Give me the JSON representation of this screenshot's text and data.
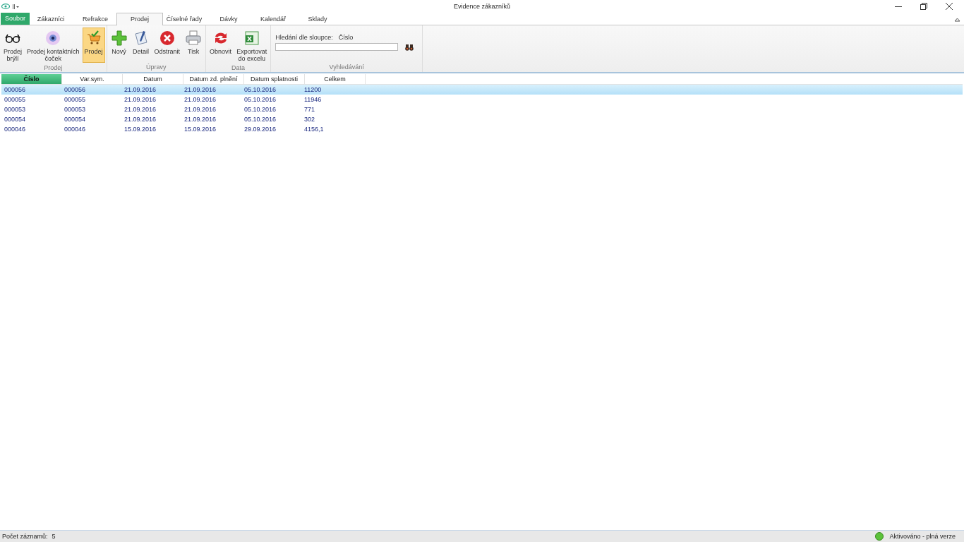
{
  "window": {
    "title": "Evidence zákazníků"
  },
  "file_tab": {
    "label": "Soubor"
  },
  "tabs": [
    {
      "label": "Zákazníci",
      "selected": false
    },
    {
      "label": "Refrakce",
      "selected": false
    },
    {
      "label": "Prodej",
      "selected": true
    },
    {
      "label": "Číselné řady",
      "selected": false
    },
    {
      "label": "Dávky",
      "selected": false
    },
    {
      "label": "Kalendář",
      "selected": false
    },
    {
      "label": "Sklady",
      "selected": false
    }
  ],
  "ribbon": {
    "groups": [
      {
        "label": "Prodej",
        "buttons": [
          {
            "lines": [
              "Prodej",
              "brýlí"
            ],
            "kind": "glasses",
            "selected": false
          },
          {
            "lines": [
              "Prodej kontaktních",
              "čoček"
            ],
            "kind": "eye",
            "selected": false
          },
          {
            "lines": [
              "Prodej"
            ],
            "kind": "cart",
            "selected": true
          }
        ]
      },
      {
        "label": "Úpravy",
        "buttons": [
          {
            "lines": [
              "Nový"
            ],
            "kind": "plus",
            "selected": false
          },
          {
            "lines": [
              "Detail"
            ],
            "kind": "notes",
            "selected": false
          },
          {
            "lines": [
              "Odstranit"
            ],
            "kind": "delete",
            "selected": false
          },
          {
            "lines": [
              "Tisk"
            ],
            "kind": "printer",
            "selected": false
          }
        ]
      },
      {
        "label": "Data",
        "buttons": [
          {
            "lines": [
              "Obnovit"
            ],
            "kind": "refresh",
            "selected": false
          },
          {
            "lines": [
              "Exportovat",
              "do excelu"
            ],
            "kind": "excel",
            "selected": false
          }
        ]
      }
    ],
    "search": {
      "label": "Hledání dle sloupce:",
      "column": "Číslo",
      "group_label": "Vyhledávání"
    }
  },
  "table": {
    "columns": [
      {
        "label": "Číslo",
        "sorted": true
      },
      {
        "label": "Var.sym.",
        "sorted": false
      },
      {
        "label": "Datum",
        "sorted": false
      },
      {
        "label": "Datum zd. plnění",
        "sorted": false
      },
      {
        "label": "Datum splatnosti",
        "sorted": false
      },
      {
        "label": "Celkem",
        "sorted": false
      }
    ],
    "rows": [
      {
        "selected": true,
        "cells": [
          "000056",
          "000056",
          "21.09.2016",
          "21.09.2016",
          "05.10.2016",
          "11200"
        ]
      },
      {
        "selected": false,
        "cells": [
          "000055",
          "000055",
          "21.09.2016",
          "21.09.2016",
          "05.10.2016",
          "11946"
        ]
      },
      {
        "selected": false,
        "cells": [
          "000053",
          "000053",
          "21.09.2016",
          "21.09.2016",
          "05.10.2016",
          "771"
        ]
      },
      {
        "selected": false,
        "cells": [
          "000054",
          "000054",
          "21.09.2016",
          "21.09.2016",
          "05.10.2016",
          "302"
        ]
      },
      {
        "selected": false,
        "cells": [
          "000046",
          "000046",
          "15.09.2016",
          "15.09.2016",
          "29.09.2016",
          "4156,1"
        ]
      }
    ]
  },
  "status_bar": {
    "count_label": "Počet záznamů:",
    "count": "5",
    "activation": "Aktivováno - plná verze"
  }
}
